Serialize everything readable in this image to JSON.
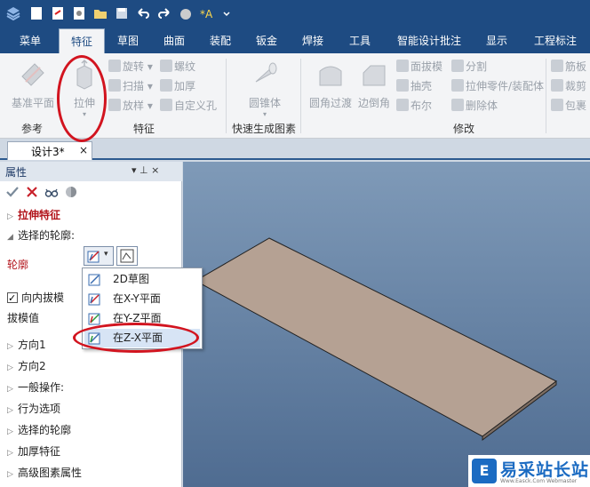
{
  "ribbon_tabs": [
    "菜单",
    "特征",
    "草图",
    "曲面",
    "装配",
    "钣金",
    "焊接",
    "工具",
    "智能设计批注",
    "显示",
    "工程标注"
  ],
  "active_tab": "特征",
  "ribbon": {
    "ref_plane": "基准平面",
    "extrude": "拉伸",
    "revolve": "旋转",
    "sweep": "扫描",
    "loft": "放样",
    "thread": "螺纹",
    "thicken": "加厚",
    "custom_hole": "自定义孔",
    "cone": "圆锥体",
    "fillet": "圆角过渡",
    "chamfer": "边倒角",
    "face_draft": "面拔模",
    "shell": "抽壳",
    "boolean": "布尔",
    "split": "分割",
    "extrude_part": "拉伸零件/装配体",
    "delete_body": "删除体",
    "rib": "筋板",
    "trim": "裁剪",
    "wrap": "包裹",
    "groups": {
      "reference": "参考",
      "feature": "特征",
      "quick_gen": "快速生成图素",
      "modify": "修改"
    }
  },
  "doc_tab": {
    "title": "设计3*",
    "close": "×"
  },
  "panel": {
    "title": "属性",
    "pin": "▾  ⊥  ×",
    "items": {
      "extrude_feature": "拉伸特征",
      "selected_profile": "选择的轮廓:",
      "profile": "轮廓",
      "inner_draft": "向内拔模",
      "draft_value": "拔模值",
      "direction1": "方向1",
      "direction2": "方向2",
      "general_ops": "一般操作:",
      "behavior": "行为选项",
      "selected_profile2": "选择的轮廓",
      "thicken_feature": "加厚特征",
      "advanced": "高级图素属性"
    }
  },
  "dropdown": {
    "items": [
      "2D草图",
      "在X-Y平面",
      "在Y-Z平面",
      "在Z-X平面"
    ],
    "highlighted": "在Z-X平面"
  },
  "watermark": {
    "text": "易采站长站",
    "sub": "Www.Easck.Com  Webmaster",
    "logo": "E"
  },
  "colors": {
    "accent": "#1e4b82",
    "annotation": "#d2141f",
    "plate": "#b5a193",
    "viewport_top": "#7f9ab8",
    "viewport_bottom": "#4f6c91"
  }
}
